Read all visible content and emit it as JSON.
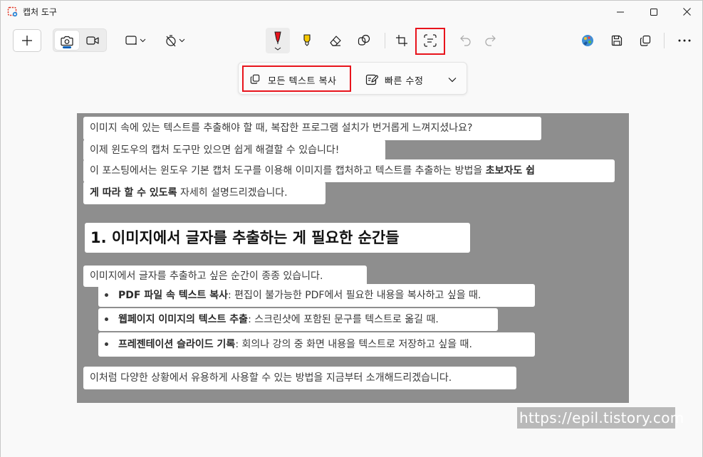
{
  "titlebar": {
    "title": "캡처 도구",
    "icons": [
      "snipping-tool-app-icon",
      "minimize-icon",
      "maximize-icon",
      "close-icon"
    ]
  },
  "toolbar": {
    "items": [
      "new-snip",
      "photo-mode",
      "video-mode",
      "snip-shape",
      "delay-timer",
      "ballpoint-pen",
      "highlighter",
      "eraser",
      "shapes",
      "crop",
      "text-actions",
      "undo",
      "redo",
      "paint-3d",
      "save",
      "copy",
      "more"
    ],
    "selected_tool": "ballpoint-pen",
    "active_mode": "photo",
    "accent_color": "#005fb8",
    "highlight_color": "#e8141c"
  },
  "text_actions": {
    "copy_all_label": "모든 텍스트 복사",
    "quick_redact_label": "빠른 수정"
  },
  "captured_image": {
    "paragraph1": [
      "이미지 속에 있는 텍스트를 추출해야 할 때, 복잡한 프로그램 설치가 번거롭게 느껴지셨나요?",
      "이제 윈도우의 캡처 도구만 있으면 쉽게 해결할 수 있습니다!",
      "이 포스팅에서는 윈도우 기본 캡처 도구를 이용해 이미지를 캡처하고 텍스트를 추출하는 방법을 "
    ],
    "paragraph1_bold_tail": "초보자도 쉽",
    "paragraph1_line4_bold": "게 따라 할 수 있도록",
    "paragraph1_line4_rest": " 자세히 설명드리겠습니다.",
    "heading": "1. 이미지에서 글자를 추출하는 게 필요한 순간들",
    "intro": "이미지에서 글자를 추출하고 싶은 순간이 종종 있습니다.",
    "bullets": [
      {
        "bold": "PDF 파일 속 텍스트 복사",
        "rest": ": 편집이 불가능한 PDF에서 필요한 내용을 복사하고 싶을 때."
      },
      {
        "bold": "웹페이지 이미지의 텍스트 추출",
        "rest": ": 스크린샷에 포함된 문구를 텍스트로 옮길 때."
      },
      {
        "bold": "프레젠테이션 슬라이드 기록",
        "rest": ": 회의나 강의 중 화면 내용을 텍스트로 저장하고 싶을 때."
      }
    ],
    "closing": "이처럼 다양한 상황에서 유용하게 사용할 수 있는 방법을 지금부터 소개해드리겠습니다."
  },
  "watermark": "https://epil.tistory.com"
}
